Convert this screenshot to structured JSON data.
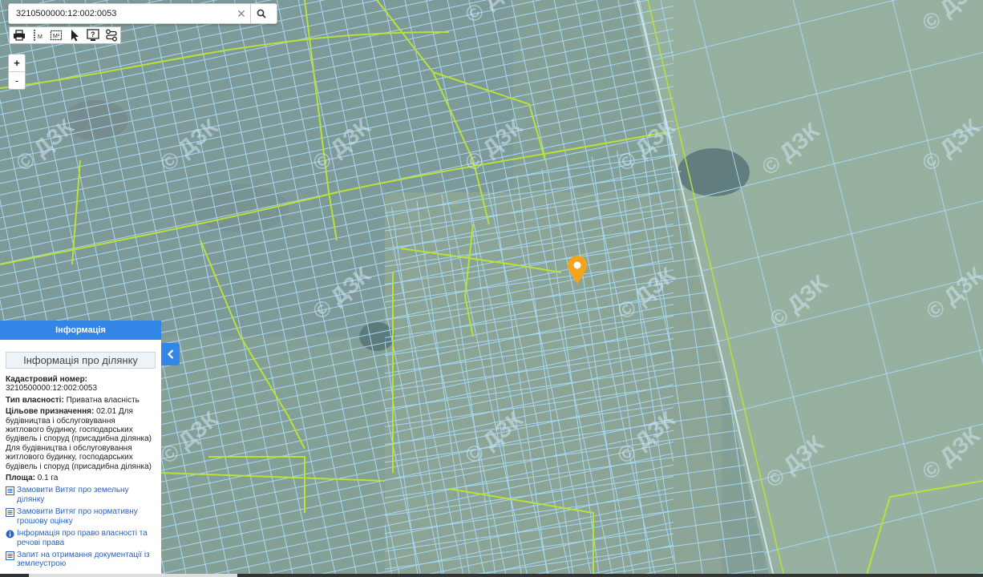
{
  "search": {
    "value": "3210500000:12:002:0053"
  },
  "toolbar": {
    "tools": [
      "printer-icon",
      "measure-distance-icon",
      "measure-area-icon",
      "pointer-icon",
      "help-icon",
      "route-icon"
    ]
  },
  "zoom": {
    "in_label": "+",
    "out_label": "-"
  },
  "watermark": "© ДЗК",
  "panel": {
    "header": "Інформація",
    "subheader": "Інформація про ділянку",
    "cadastral_label": "Кадастровий номер:",
    "cadastral_value": "3210500000:12:002:0053",
    "ownership_label": "Тип власності:",
    "ownership_value": "Приватна власність",
    "purpose_label": "Цільове призначення:",
    "purpose_value": "02.01 Для будівництва і обслуговування житлового будинку, господарських будівель і споруд (присадибна ділянка) Для будівництва і обслуговування житлового будинку, господарських будівель і споруд (присадибна ділянка)",
    "area_label": "Площа:",
    "area_value": "0.1 га",
    "links": [
      "Замовити Витяг про земельну ділянку",
      "Замовити Витяг про нормативну грошову оцінку",
      "Інформація про право власності та речові права",
      "Запит на отримання документації із землеустрою"
    ]
  },
  "colors": {
    "parcel": "#9fd1ee",
    "boundary": "#b8e23a",
    "marker": "#f2a51c",
    "panel_header": "#3385e6"
  }
}
